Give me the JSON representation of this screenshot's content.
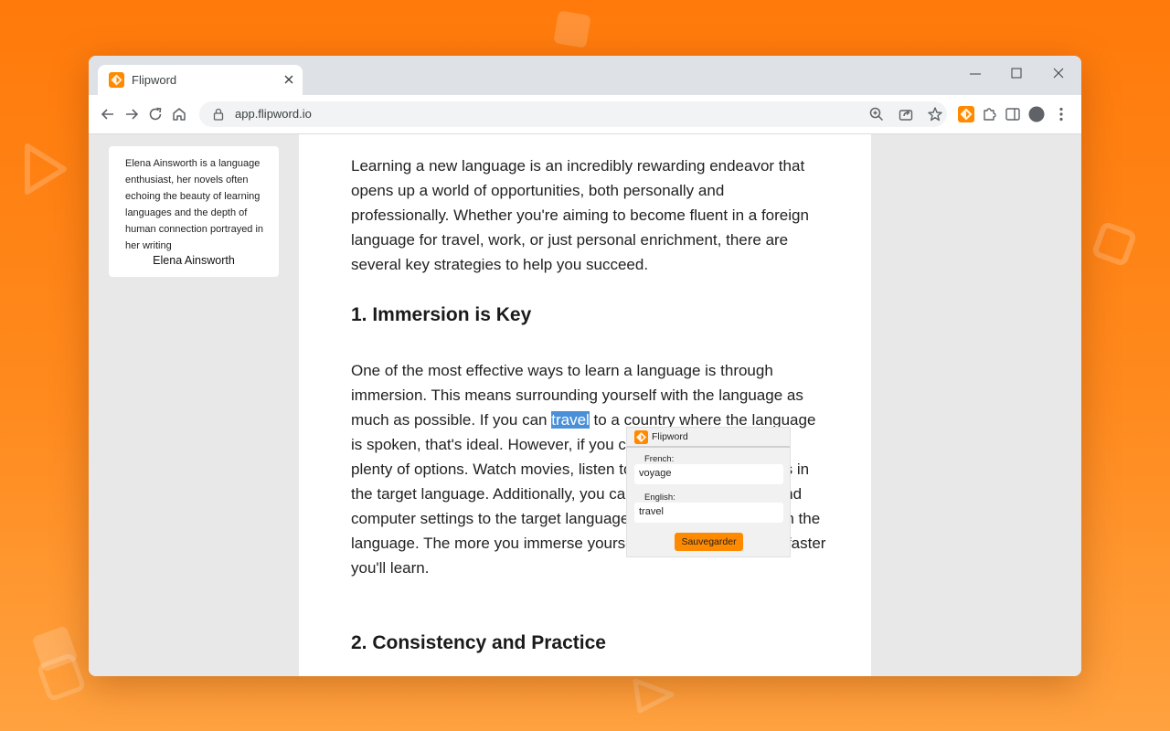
{
  "colors": {
    "accent": "#ff8a00",
    "highlight": "#4a90d9"
  },
  "tab": {
    "title": "Flipword",
    "favicon": "flipword-logo-icon"
  },
  "address_bar": {
    "url": "app.flipword.io"
  },
  "sidebar": {
    "quote": "Elena Ainsworth is a language enthusiast, her novels often echoing the beauty of learning languages and the depth of human connection portrayed in her writing",
    "author": "Elena Ainsworth"
  },
  "article": {
    "intro": "Learning a new language is an incredibly rewarding endeavor that opens up a world of opportunities, both personally and professionally. Whether you're aiming to become fluent in a foreign language for travel, work, or just personal enrichment, there are several key strategies to help you succeed.",
    "heading1": "1. Immersion is Key",
    "para2_before": "One of the most effective ways to learn a language is through immersion. This means surrounding yourself with the language as much as possible. If you can ",
    "para2_highlight": "travel",
    "para2_after": " to a country where the language is spoken, that's ideal. However, if you can't travel, there are still plenty of options. Watch movies, listen to music, and read books in the target language. Additionally, you can change your phone and computer settings to the target language, and even try to think in the language. The more you immerse yourself in the language, the faster you'll learn.",
    "heading2": "2. Consistency and Practice"
  },
  "popup": {
    "title": "Flipword",
    "french_label": "French:",
    "french_value": "voyage",
    "english_label": "English:",
    "english_value": "travel",
    "save_label": "Sauvegarder"
  }
}
